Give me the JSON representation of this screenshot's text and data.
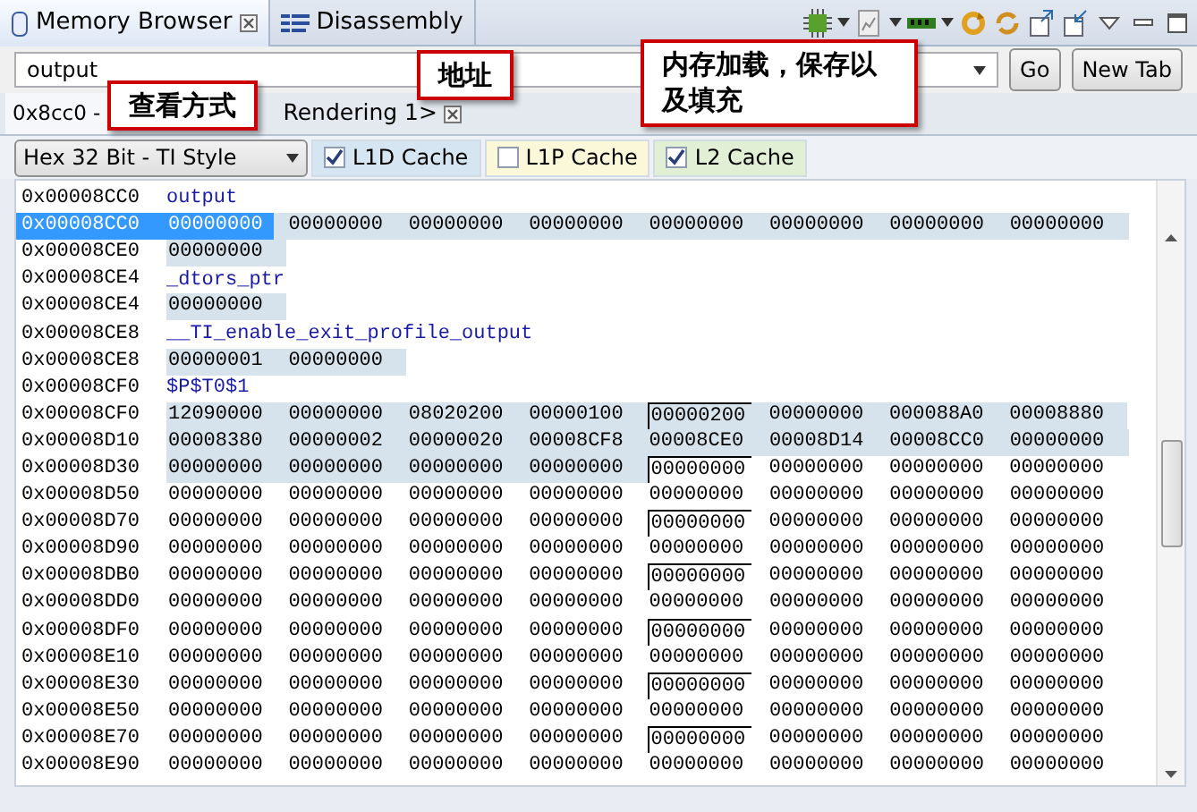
{
  "view_tabs": [
    {
      "label": "Memory Browser",
      "selected": true,
      "closable": true
    },
    {
      "label": "Disassembly",
      "selected": false,
      "closable": false
    }
  ],
  "address_bar": {
    "value": "output",
    "go": "Go",
    "new_tab": "New Tab"
  },
  "rendering_tabs": [
    {
      "label": "0x8cc0 -",
      "selected": true
    },
    {
      "label": "Rendering 1>",
      "selected": false
    }
  ],
  "format": "Hex 32 Bit - TI Style",
  "caches": [
    {
      "label": "L1D Cache",
      "checked": true,
      "color": "#d6e5f2"
    },
    {
      "label": "L1P Cache",
      "checked": false,
      "color": "#fbf8d9"
    },
    {
      "label": "L2 Cache",
      "checked": true,
      "color": "#e1f0d4"
    }
  ],
  "rows": [
    {
      "kind": "symbol",
      "address": "0x00008CC0",
      "text": "output"
    },
    {
      "kind": "data",
      "address": "0x00008CC0",
      "selected": true,
      "boxed": false,
      "groups": [
        {
          "cached": true,
          "cells": [
            "00000000",
            "00000000",
            "00000000",
            "00000000",
            "00000000",
            "00000000",
            "00000000",
            "00000000"
          ]
        }
      ]
    },
    {
      "kind": "data",
      "address": "0x00008CE0",
      "selected": false,
      "boxed": false,
      "groups": [
        {
          "cached": true,
          "cells": [
            "00000000"
          ]
        }
      ]
    },
    {
      "kind": "symbol",
      "address": "0x00008CE4",
      "text": "_dtors_ptr"
    },
    {
      "kind": "data",
      "address": "0x00008CE4",
      "selected": false,
      "boxed": false,
      "groups": [
        {
          "cached": true,
          "cells": [
            "00000000"
          ]
        }
      ]
    },
    {
      "kind": "symbol",
      "address": "0x00008CE8",
      "text": "__TI_enable_exit_profile_output"
    },
    {
      "kind": "data",
      "address": "0x00008CE8",
      "selected": false,
      "boxed": false,
      "groups": [
        {
          "cached": true,
          "cells": [
            "00000001",
            "00000000"
          ]
        }
      ]
    },
    {
      "kind": "symbol",
      "address": "0x00008CF0",
      "text": "$P$T0$1"
    },
    {
      "kind": "data",
      "address": "0x00008CF0",
      "selected": false,
      "boxed": true,
      "groups": [
        {
          "cached": true,
          "cells": [
            "12090000",
            "00000000",
            "08020200",
            "00000100",
            "00000200",
            "00000000",
            "000088A0",
            "00008880"
          ]
        }
      ]
    },
    {
      "kind": "data",
      "address": "0x00008D10",
      "selected": false,
      "boxed": false,
      "groups": [
        {
          "cached": true,
          "cells": [
            "00008380",
            "00000002",
            "00000020",
            "00008CF8",
            "00008CE0",
            "00008D14",
            "00008CC0",
            "00000000"
          ]
        }
      ]
    },
    {
      "kind": "data",
      "address": "0x00008D30",
      "selected": false,
      "boxed": true,
      "groups": [
        {
          "cached": true,
          "cells": [
            "00000000",
            "00000000",
            "00000000",
            "00000000"
          ]
        },
        {
          "cached": false,
          "cells": [
            "00000000",
            "00000000",
            "00000000",
            "00000000"
          ]
        }
      ]
    },
    {
      "kind": "data",
      "address": "0x00008D50",
      "selected": false,
      "boxed": false,
      "groups": [
        {
          "cached": false,
          "cells": [
            "00000000",
            "00000000",
            "00000000",
            "00000000",
            "00000000",
            "00000000",
            "00000000",
            "00000000"
          ]
        }
      ]
    },
    {
      "kind": "data",
      "address": "0x00008D70",
      "selected": false,
      "boxed": true,
      "groups": [
        {
          "cached": false,
          "cells": [
            "00000000",
            "00000000",
            "00000000",
            "00000000",
            "00000000",
            "00000000",
            "00000000",
            "00000000"
          ]
        }
      ]
    },
    {
      "kind": "data",
      "address": "0x00008D90",
      "selected": false,
      "boxed": false,
      "groups": [
        {
          "cached": false,
          "cells": [
            "00000000",
            "00000000",
            "00000000",
            "00000000",
            "00000000",
            "00000000",
            "00000000",
            "00000000"
          ]
        }
      ]
    },
    {
      "kind": "data",
      "address": "0x00008DB0",
      "selected": false,
      "boxed": true,
      "groups": [
        {
          "cached": false,
          "cells": [
            "00000000",
            "00000000",
            "00000000",
            "00000000",
            "00000000",
            "00000000",
            "00000000",
            "00000000"
          ]
        }
      ]
    },
    {
      "kind": "data",
      "address": "0x00008DD0",
      "selected": false,
      "boxed": false,
      "groups": [
        {
          "cached": false,
          "cells": [
            "00000000",
            "00000000",
            "00000000",
            "00000000",
            "00000000",
            "00000000",
            "00000000",
            "00000000"
          ]
        }
      ]
    },
    {
      "kind": "data",
      "address": "0x00008DF0",
      "selected": false,
      "boxed": true,
      "groups": [
        {
          "cached": false,
          "cells": [
            "00000000",
            "00000000",
            "00000000",
            "00000000",
            "00000000",
            "00000000",
            "00000000",
            "00000000"
          ]
        }
      ]
    },
    {
      "kind": "data",
      "address": "0x00008E10",
      "selected": false,
      "boxed": false,
      "groups": [
        {
          "cached": false,
          "cells": [
            "00000000",
            "00000000",
            "00000000",
            "00000000",
            "00000000",
            "00000000",
            "00000000",
            "00000000"
          ]
        }
      ]
    },
    {
      "kind": "data",
      "address": "0x00008E30",
      "selected": false,
      "boxed": true,
      "groups": [
        {
          "cached": false,
          "cells": [
            "00000000",
            "00000000",
            "00000000",
            "00000000",
            "00000000",
            "00000000",
            "00000000",
            "00000000"
          ]
        }
      ]
    },
    {
      "kind": "data",
      "address": "0x00008E50",
      "selected": false,
      "boxed": false,
      "groups": [
        {
          "cached": false,
          "cells": [
            "00000000",
            "00000000",
            "00000000",
            "00000000",
            "00000000",
            "00000000",
            "00000000",
            "00000000"
          ]
        }
      ]
    },
    {
      "kind": "data",
      "address": "0x00008E70",
      "selected": false,
      "boxed": true,
      "groups": [
        {
          "cached": false,
          "cells": [
            "00000000",
            "00000000",
            "00000000",
            "00000000",
            "00000000",
            "00000000",
            "00000000",
            "00000000"
          ]
        }
      ]
    },
    {
      "kind": "data",
      "address": "0x00008E90",
      "selected": false,
      "boxed": false,
      "groups": [
        {
          "cached": false,
          "cells": [
            "00000000",
            "00000000",
            "00000000",
            "00000000",
            "00000000",
            "00000000",
            "00000000",
            "00000000"
          ]
        }
      ]
    }
  ],
  "callouts": [
    {
      "text": "查看方式"
    },
    {
      "text": "地址"
    },
    {
      "text": "内存加载，保存以及填充"
    }
  ]
}
